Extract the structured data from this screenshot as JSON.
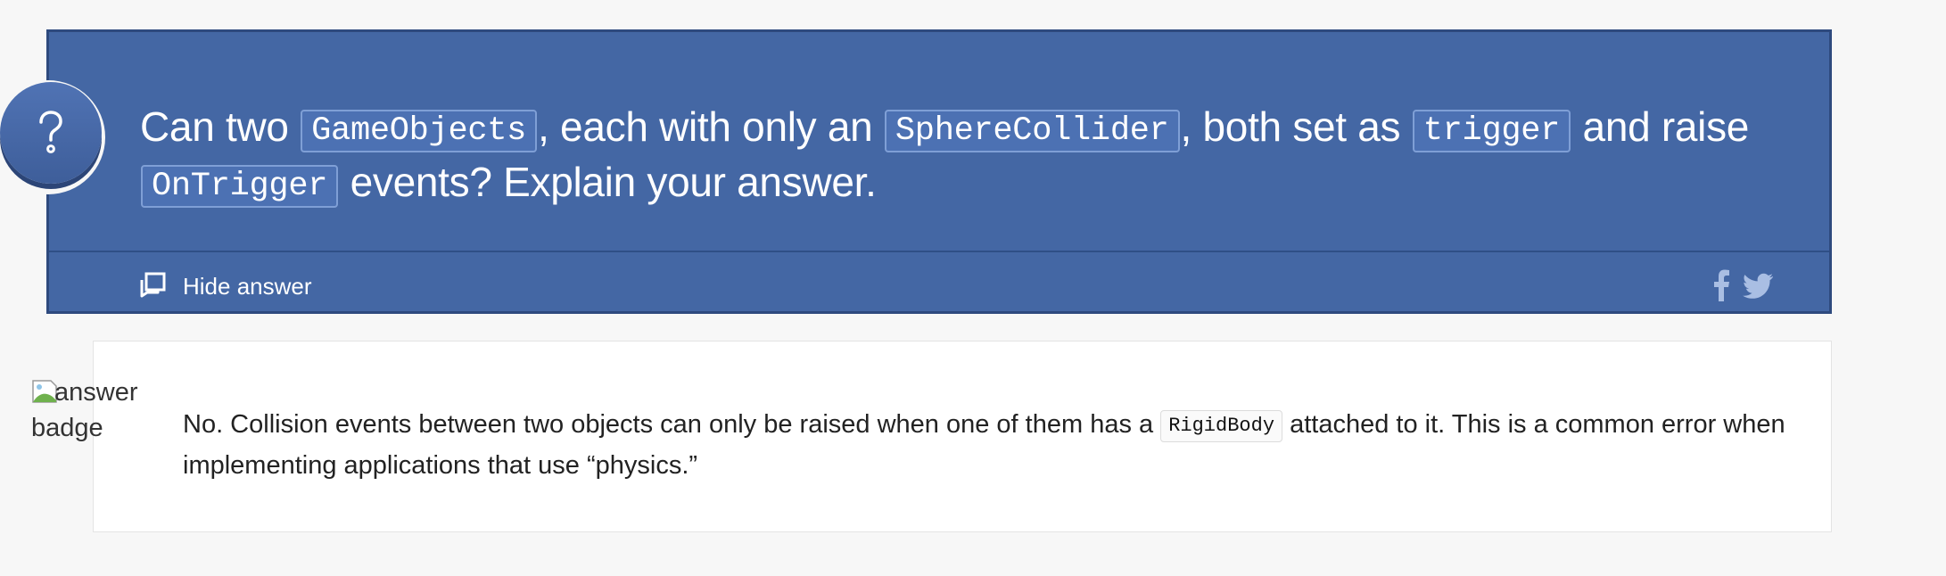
{
  "question": {
    "segments": [
      {
        "type": "text",
        "value": "Can two "
      },
      {
        "type": "code",
        "value": "GameObjects"
      },
      {
        "type": "text",
        "value": ", each with only an "
      },
      {
        "type": "code",
        "value": "SphereCollider"
      },
      {
        "type": "text",
        "value": ", both set as "
      },
      {
        "type": "code",
        "value": "trigger"
      },
      {
        "type": "text",
        "value": " and raise "
      },
      {
        "type": "code",
        "value": "OnTrigger"
      },
      {
        "type": "text",
        "value": " events? Explain your answer."
      }
    ],
    "badge_icon": "question-mark-icon",
    "hide_answer_label": "Hide answer",
    "hide_answer_icon": "hide-answer-icon",
    "share_icons": [
      "facebook-icon",
      "twitter-icon"
    ]
  },
  "answer": {
    "badge_alt": "answer badge",
    "segments": [
      {
        "type": "text",
        "value": "No. Collision events between two objects can only be raised when one of them has a "
      },
      {
        "type": "code",
        "value": "RigidBody"
      },
      {
        "type": "text",
        "value": " attached to it. This is a common error when implementing applications that use “physics.”"
      }
    ]
  },
  "colors": {
    "question_bg": "#4467a4",
    "question_border": "#2e4a7e",
    "page_bg": "#f7f7f7",
    "answer_bg": "#ffffff"
  }
}
